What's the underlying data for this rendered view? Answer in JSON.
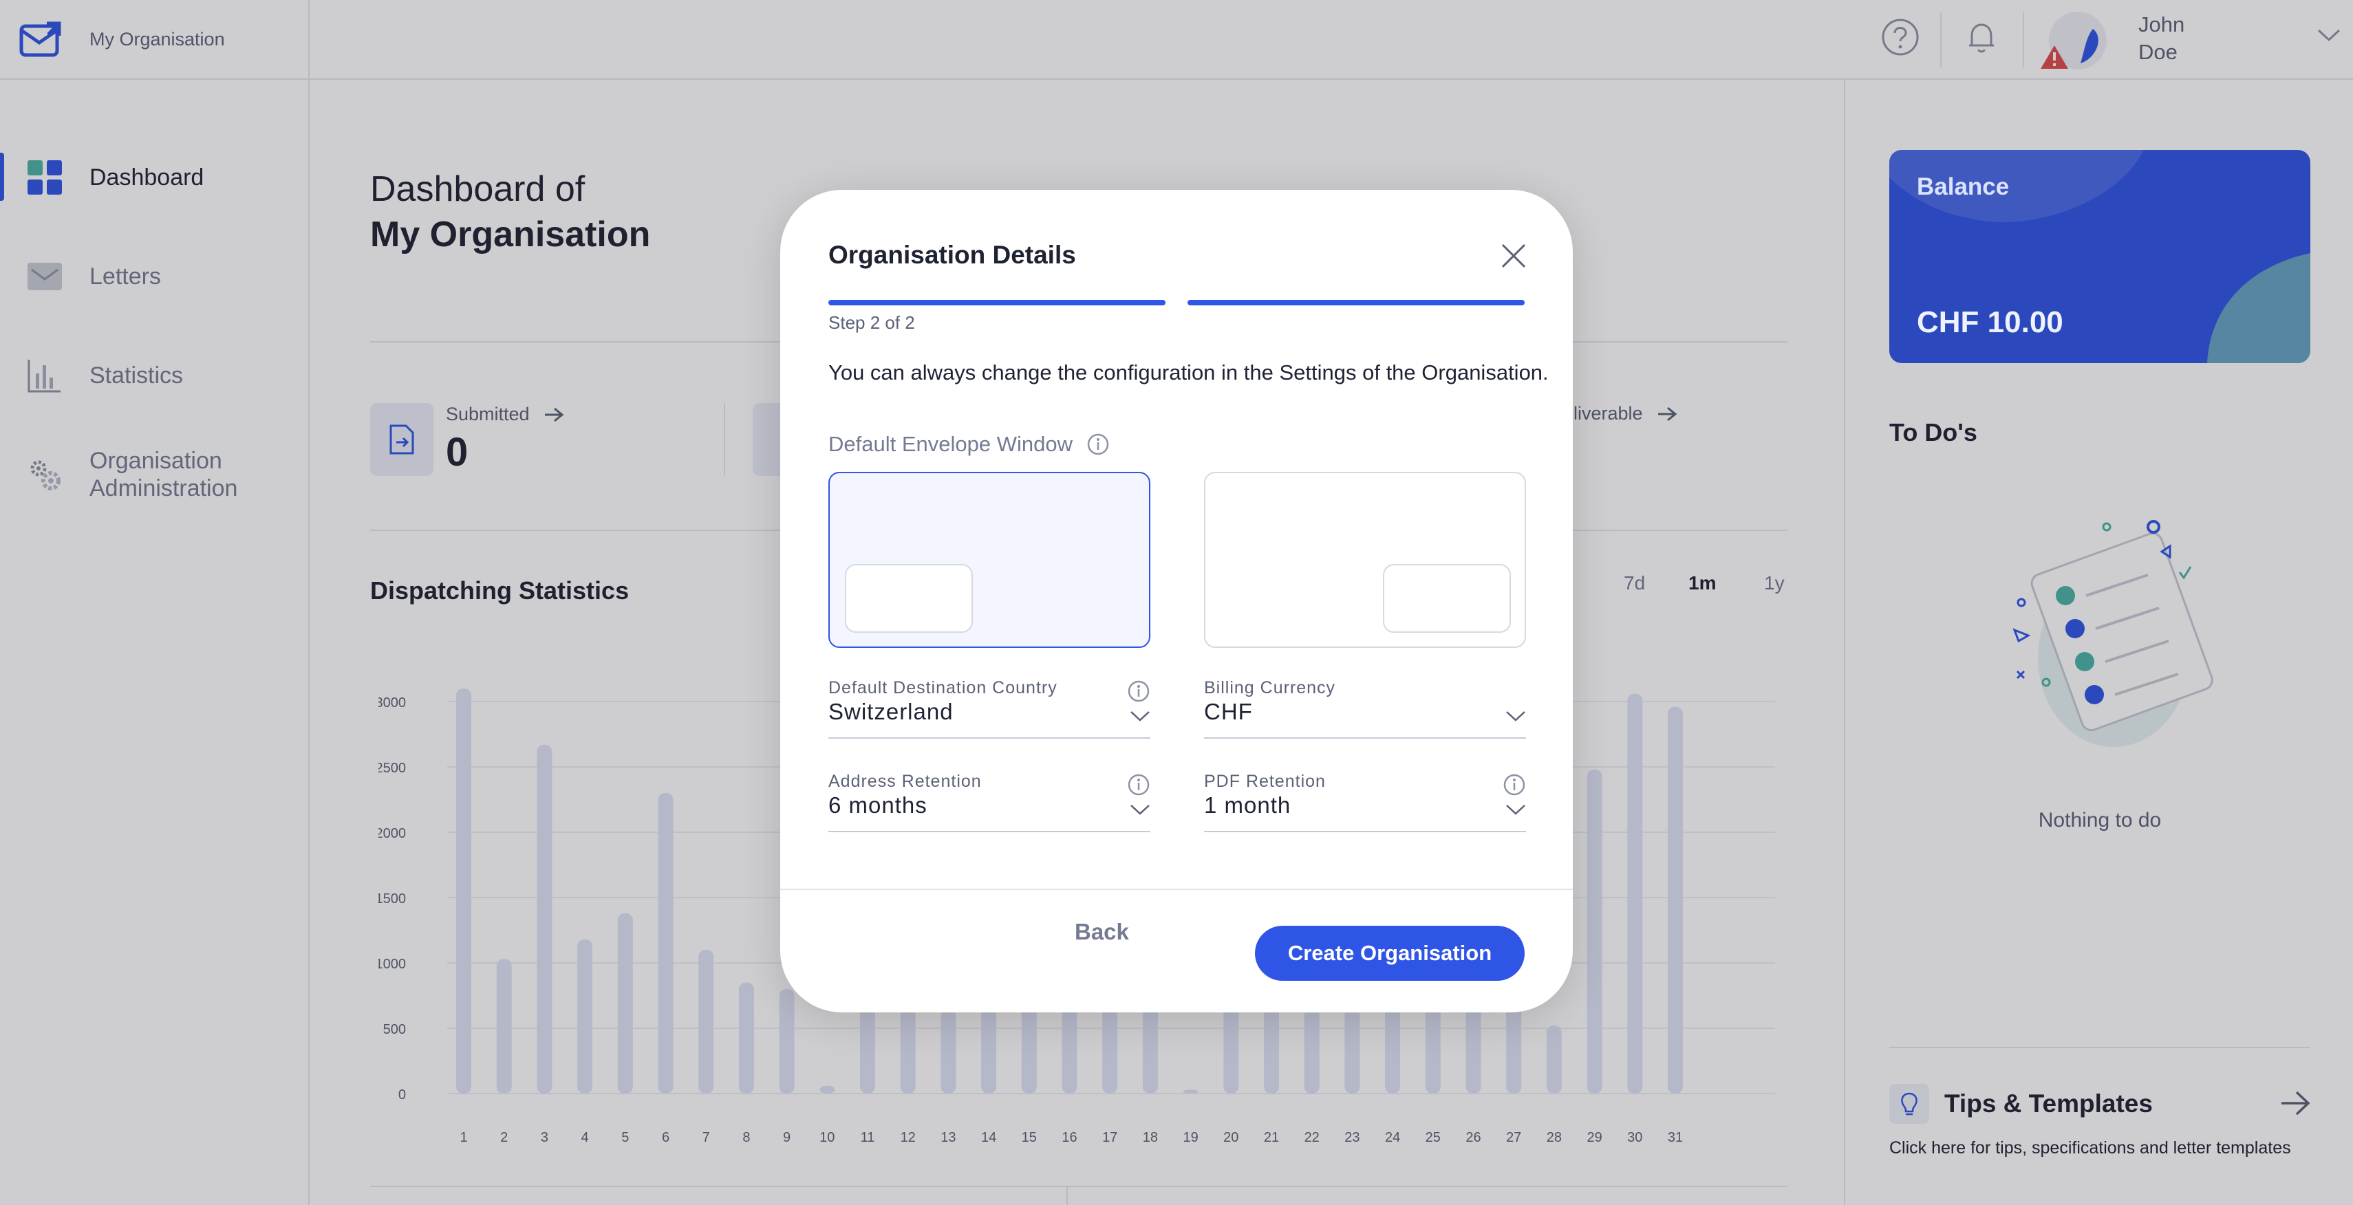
{
  "app": {
    "org_name": "My Organisation"
  },
  "sidebar": {
    "items": [
      {
        "label": "Dashboard",
        "icon": "dashboard-icon",
        "active": true
      },
      {
        "label": "Letters",
        "icon": "letter-icon"
      },
      {
        "label": "Statistics",
        "icon": "statistics-icon"
      },
      {
        "label": "Organisation Administration",
        "icon": "gear-icon"
      }
    ]
  },
  "header": {
    "help_icon": "help-icon",
    "bell_icon": "bell-icon",
    "user_first": "John",
    "user_last": "Doe",
    "user_alert_icon": "warning-icon"
  },
  "dashboard": {
    "title_line1": "Dashboard of",
    "title_line2": "My Organisation",
    "stats": {
      "submitted_label": "Submitted",
      "submitted_value": "0",
      "third_label": "eliverable"
    },
    "section_title": "Dispatching Statistics",
    "ranges": [
      "7d",
      "1m",
      "1y"
    ],
    "active_range": "1m"
  },
  "chart_data": {
    "type": "bar",
    "categories": [
      "1",
      "2",
      "3",
      "4",
      "5",
      "6",
      "7",
      "8",
      "9",
      "10",
      "11",
      "12",
      "13",
      "14",
      "15",
      "16",
      "17",
      "18",
      "19",
      "20",
      "21",
      "22",
      "23",
      "24",
      "25",
      "26",
      "27",
      "28",
      "29",
      "30",
      "31"
    ],
    "values": [
      3100,
      1030,
      2670,
      1180,
      1380,
      2300,
      1100,
      850,
      800,
      60,
      780,
      700,
      650,
      760,
      720,
      800,
      830,
      760,
      30,
      880,
      790,
      870,
      780,
      900,
      820,
      800,
      950,
      520,
      2480,
      3060,
      2960
    ],
    "ylim": [
      0,
      3000
    ],
    "yticks": [
      0,
      500,
      1000,
      1500,
      2000,
      2500,
      3000
    ],
    "colors": {
      "bar": "#dfe3f7"
    }
  },
  "right_panel": {
    "balance_label": "Balance",
    "balance_amount": "CHF 10.00",
    "todo_title": "To Do's",
    "todo_empty": "Nothing to do",
    "tips_title": "Tips & Templates",
    "tips_desc": "Click here for tips, specifications and letter templates"
  },
  "modal": {
    "title": "Organisation Details",
    "step": "Step 2 of 2",
    "description": "You can always change the configuration in the Settings of the Organisation.",
    "envelope_label": "Default Envelope Window",
    "envelope_selected": "left",
    "fields": {
      "country": {
        "label": "Default Destination Country",
        "value": "Switzerland"
      },
      "currency": {
        "label": "Billing Currency",
        "value": "CHF"
      },
      "address_retention": {
        "label": "Address Retention",
        "value": "6 months"
      },
      "pdf_retention": {
        "label": "PDF Retention",
        "value": "1 month"
      }
    },
    "back_label": "Back",
    "create_label": "Create Organisation"
  },
  "colors": {
    "accent": "#2f55e6",
    "overlay": "rgba(30,32,40,0.22)"
  }
}
